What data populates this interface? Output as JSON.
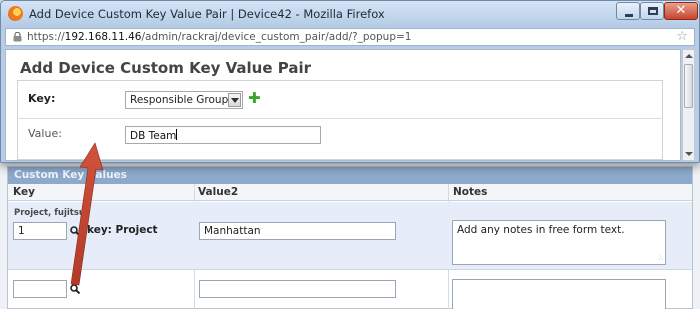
{
  "window": {
    "title": "Add Device Custom Key Value Pair | Device42 - Mozilla Firefox",
    "url_scheme": "https://",
    "url_host": "192.168.11.46",
    "url_path": "/admin/rackraj/device_custom_pair/add/?_popup=1"
  },
  "form": {
    "title": "Add Device Custom Key Value Pair",
    "key_label": "Key:",
    "key_selected": "Responsible Group",
    "value_label": "Value:",
    "value_input": "DB Team"
  },
  "background_table": {
    "caption": "Custom Key Values",
    "headers": [
      "Key",
      "Value2",
      "Notes"
    ],
    "row1": {
      "label": "Project, fujitsu",
      "key_input": "1",
      "key_text": "key: Project",
      "value2": "Manhattan",
      "notes": "Add any notes in free form text."
    }
  },
  "annotation": {
    "arrow_color": "#c0412f"
  }
}
